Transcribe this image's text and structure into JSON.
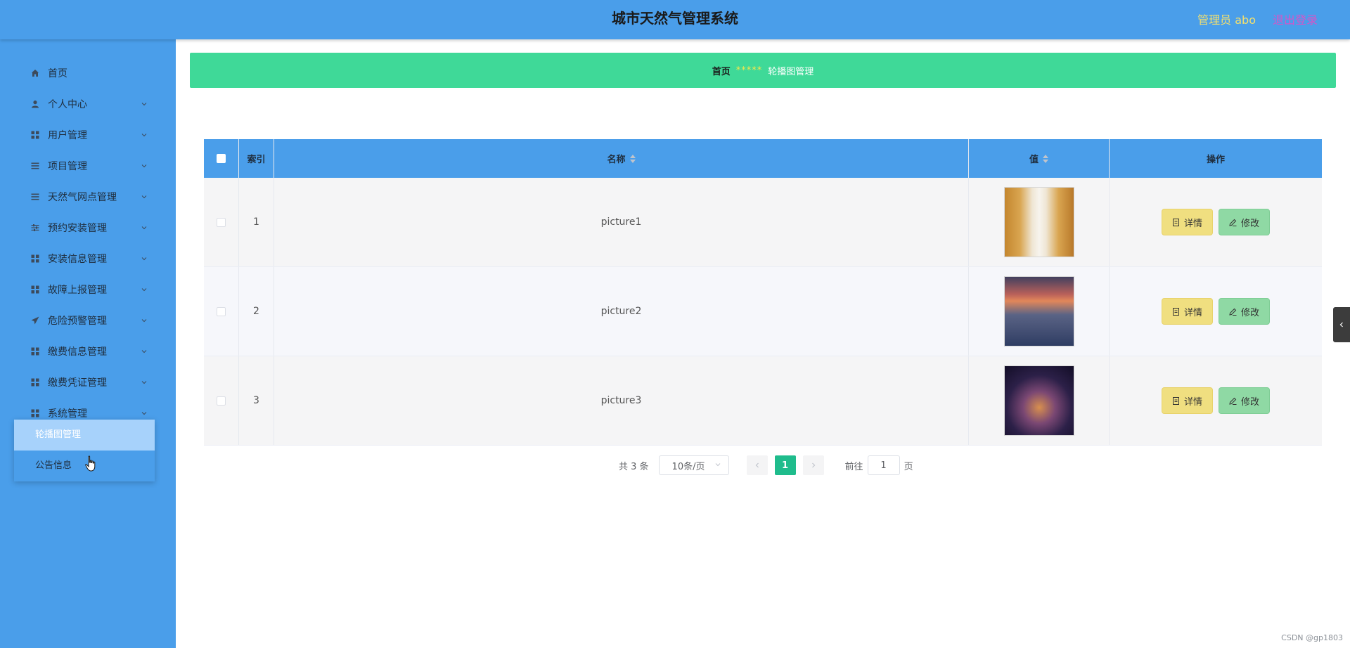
{
  "header": {
    "title": "城市天然气管理系统",
    "admin_label": "管理员 abo",
    "logout_label": "退出登录"
  },
  "sidebar": {
    "items": [
      {
        "label": "首页",
        "icon": "home-icon",
        "has_children": false
      },
      {
        "label": "个人中心",
        "icon": "user-icon",
        "has_children": true
      },
      {
        "label": "用户管理",
        "icon": "grid-icon",
        "has_children": true
      },
      {
        "label": "项目管理",
        "icon": "list-icon",
        "has_children": true
      },
      {
        "label": "天然气网点管理",
        "icon": "list-icon",
        "has_children": true
      },
      {
        "label": "预约安装管理",
        "icon": "sliders-icon",
        "has_children": true
      },
      {
        "label": "安装信息管理",
        "icon": "grid-icon",
        "has_children": true
      },
      {
        "label": "故障上报管理",
        "icon": "grid-icon",
        "has_children": true
      },
      {
        "label": "危险预警管理",
        "icon": "send-icon",
        "has_children": true
      },
      {
        "label": "缴费信息管理",
        "icon": "grid-icon",
        "has_children": true
      },
      {
        "label": "缴费凭证管理",
        "icon": "grid-icon",
        "has_children": true
      },
      {
        "label": "系统管理",
        "icon": "grid-icon",
        "has_children": true
      }
    ],
    "submenu": [
      {
        "label": "轮播图管理",
        "active": true
      },
      {
        "label": "公告信息",
        "active": false
      }
    ]
  },
  "breadcrumb": {
    "home": "首页",
    "separator": "*****",
    "current": "轮播图管理"
  },
  "table": {
    "headers": {
      "index": "索引",
      "name": "名称",
      "value": "值",
      "ops": "操作"
    },
    "rows": [
      {
        "index": "1",
        "name": "picture1",
        "image": "library-interior-photo"
      },
      {
        "index": "2",
        "name": "picture2",
        "image": "coastal-city-sunset-photo"
      },
      {
        "index": "3",
        "name": "picture3",
        "image": "night-city-skyline-photo"
      }
    ],
    "detail_label": "详情",
    "edit_label": "修改"
  },
  "pagination": {
    "total": "共 3 条",
    "page_size": "10条/页",
    "current_page": "1",
    "goto_prefix": "前往",
    "goto_value": "1",
    "goto_suffix": "页"
  },
  "watermark": "CSDN @gp1803",
  "colors": {
    "primary": "#4a9eea",
    "breadcrumb_bg": "#3fd998",
    "detail_btn": "#f0df80",
    "edit_btn": "#8fd9a4",
    "page_active": "#1fbc8c"
  }
}
